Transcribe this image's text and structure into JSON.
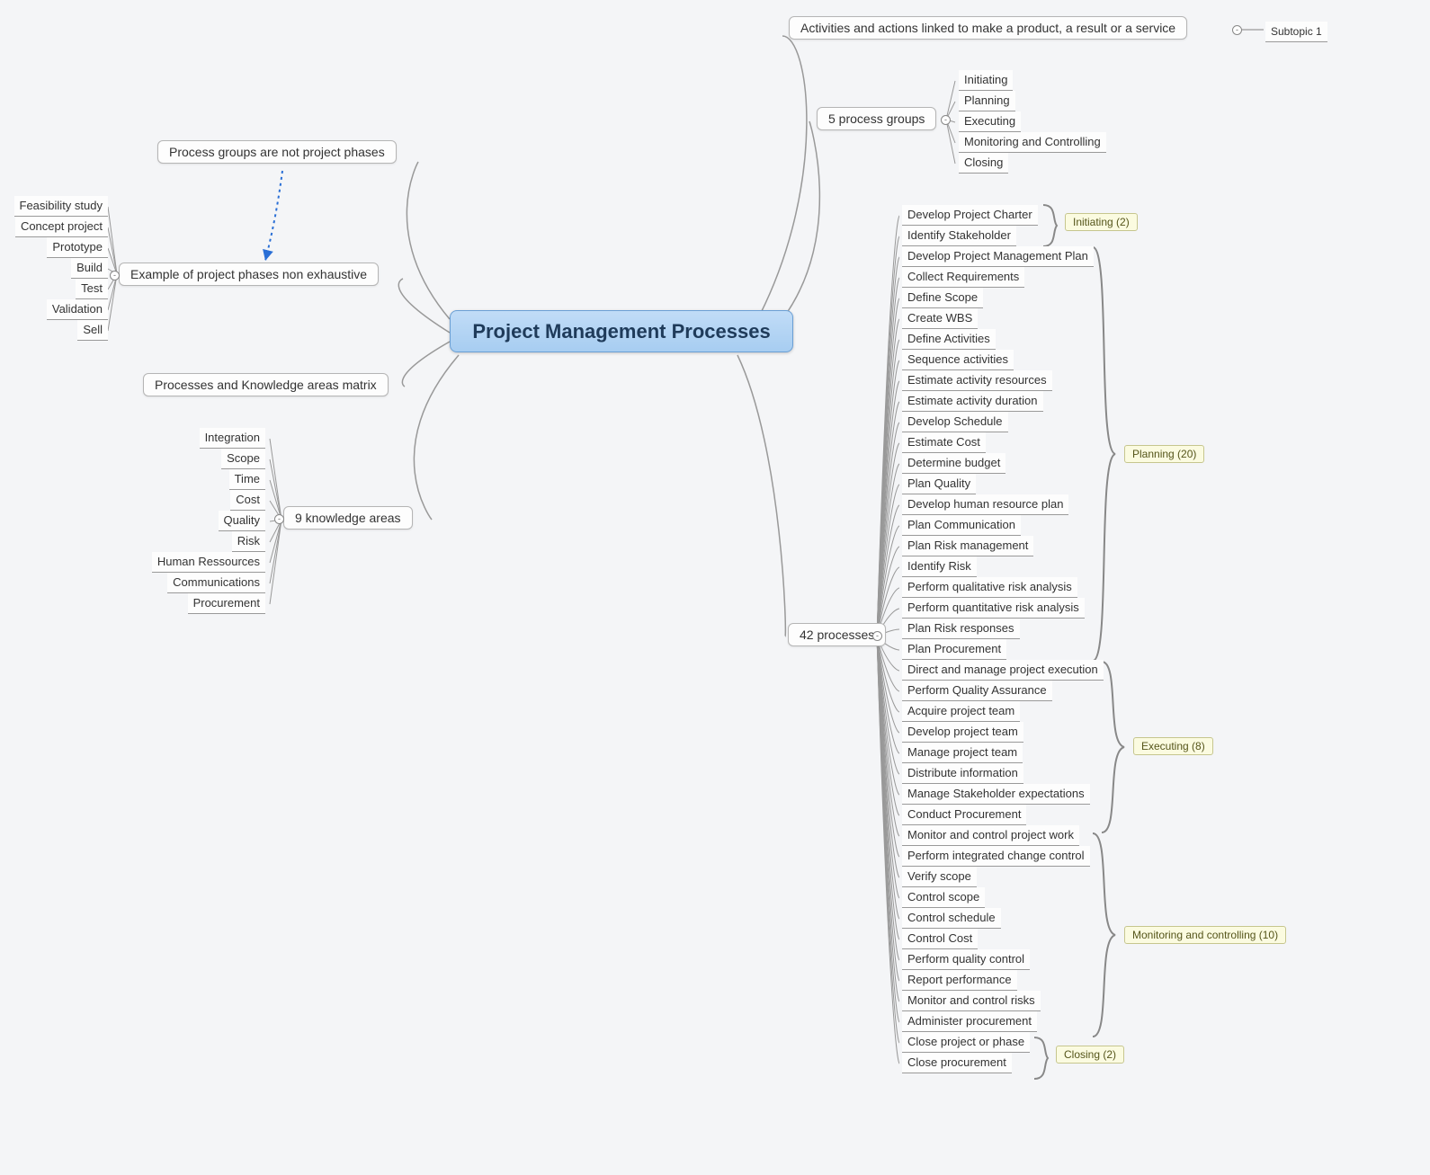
{
  "center": {
    "title": "Project Management Processes"
  },
  "left": {
    "process_groups_note": "Process groups are not project phases",
    "example": {
      "label": "Example of project phases non exhaustive",
      "items": [
        "Feasibility study",
        "Concept project",
        "Prototype",
        "Build",
        "Test",
        "Validation",
        "Sell"
      ]
    },
    "matrix": "Processes and Knowledge areas matrix",
    "knowledge": {
      "label": "9 knowledge areas",
      "items": [
        "Integration",
        "Scope",
        "Time",
        "Cost",
        "Quality",
        "Risk",
        "Human Ressources",
        "Communications",
        "Procurement"
      ]
    }
  },
  "right": {
    "activities": {
      "label": "Activities and actions linked to make a product, a result or a service",
      "sub": "Subtopic 1"
    },
    "process_groups": {
      "label": "5 process groups",
      "items": [
        "Initiating",
        "Planning",
        "Executing",
        "Monitoring and Controlling",
        "Closing"
      ]
    },
    "processes42": {
      "label": "42 processes",
      "group_initiating": {
        "label": "Initiating (2)",
        "items": [
          "Develop Project Charter",
          "Identify Stakeholder"
        ]
      },
      "group_planning": {
        "label": "Planning (20)",
        "items": [
          "Develop Project Management Plan",
          "Collect Requirements",
          "Define Scope",
          "Create WBS",
          "Define Activities",
          "Sequence activities",
          "Estimate activity resources",
          "Estimate activity duration",
          "Develop Schedule",
          "Estimate Cost",
          "Determine budget",
          "Plan Quality",
          "Develop human resource plan",
          "Plan Communication",
          "Plan Risk management",
          "Identify Risk",
          "Perform qualitative risk analysis",
          "Perform quantitative risk analysis",
          "Plan Risk responses",
          "Plan Procurement"
        ]
      },
      "group_executing": {
        "label": "Executing (8)",
        "items": [
          "Direct and manage project execution",
          "Perform Quality Assurance",
          "Acquire project team",
          "Develop project team",
          "Manage project team",
          "Distribute information",
          "Manage Stakeholder expectations",
          "Conduct Procurement"
        ]
      },
      "group_monitoring": {
        "label": "Monitoring and controlling (10)",
        "items": [
          "Monitor and control project work",
          "Perform integrated change control",
          "Verify scope",
          "Control scope",
          "Control schedule",
          "Control Cost",
          "Perform quality control",
          "Report performance",
          "Monitor and control risks",
          "Administer procurement"
        ]
      },
      "group_closing": {
        "label": "Closing (2)",
        "items": [
          "Close project or phase",
          "Close procurement"
        ]
      }
    }
  }
}
